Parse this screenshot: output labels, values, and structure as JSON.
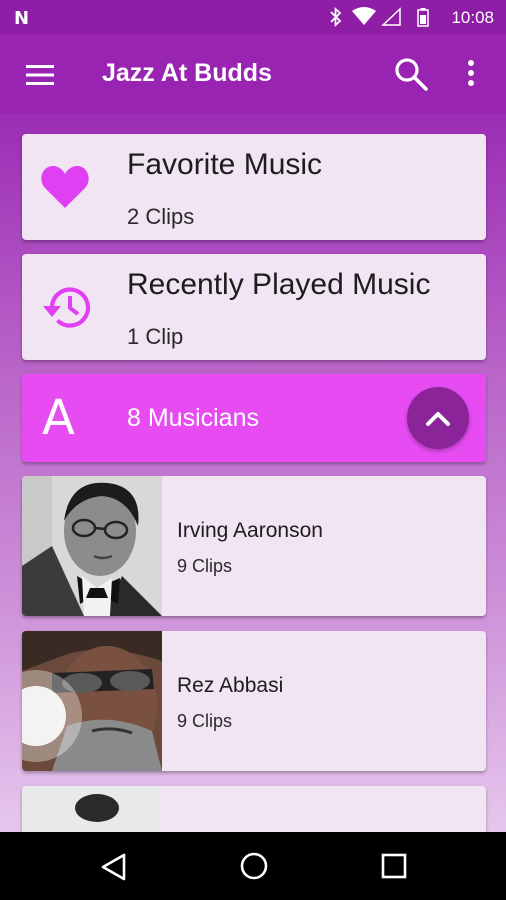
{
  "status_bar": {
    "notification_letter": "N",
    "time": "10:08"
  },
  "app_bar": {
    "title": "Jazz At Budds"
  },
  "favorites": {
    "title": "Favorite Music",
    "subtitle": "2 Clips"
  },
  "recent": {
    "title": "Recently Played Music",
    "subtitle": "1 Clip"
  },
  "musicians_header": {
    "letter": "A",
    "count_label": "8 Musicians"
  },
  "artists": [
    {
      "name": "Irving Aaronson",
      "clips": "9 Clips"
    },
    {
      "name": "Rez Abbasi",
      "clips": "9 Clips"
    }
  ],
  "colors": {
    "status_bar": "#8f1ea6",
    "app_bar": "#9a24b2",
    "accent_pink": "#e64cf2",
    "icon_magenta": "#e040f2",
    "card_bg": "#f1e4f3"
  },
  "icons": [
    "menu-icon",
    "search-icon",
    "more-vert-icon",
    "heart-icon",
    "history-icon",
    "chevron-up-icon",
    "bluetooth-icon",
    "wifi-icon",
    "signal-icon",
    "battery-icon",
    "nav-back-icon",
    "nav-home-icon",
    "nav-recents-icon"
  ]
}
